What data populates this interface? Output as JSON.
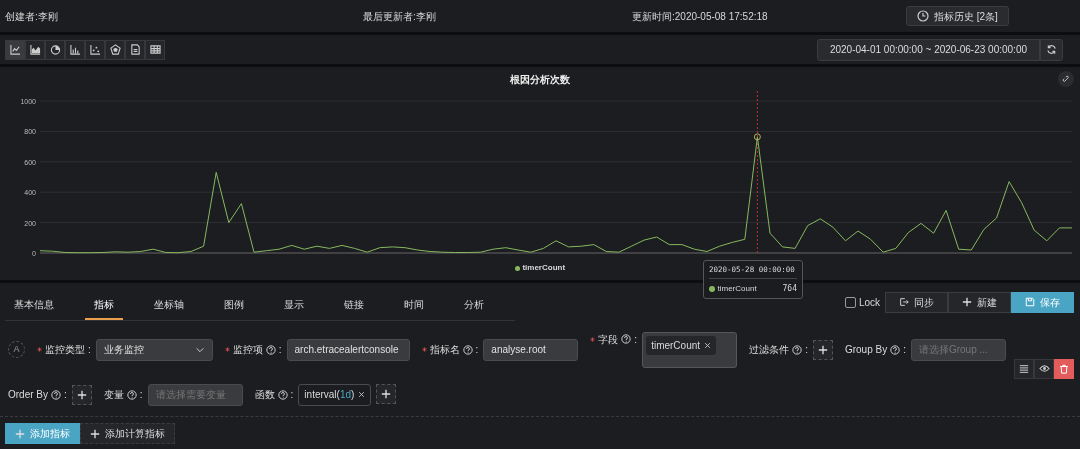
{
  "header": {
    "creator": "创建者:李刚",
    "last_editor": "最后更新者:李刚",
    "updated": "更新时间:2020-05-08 17:52:18",
    "history_button": "指标历史 [2条]"
  },
  "chart_types": [
    {
      "kind": "line",
      "selected": true
    },
    {
      "kind": "area",
      "selected": false
    },
    {
      "kind": "pie",
      "selected": false
    },
    {
      "kind": "bar",
      "selected": false
    },
    {
      "kind": "scatter",
      "selected": false
    },
    {
      "kind": "radar",
      "selected": false
    },
    {
      "kind": "document",
      "selected": false
    },
    {
      "kind": "table",
      "selected": false
    }
  ],
  "time_range": "2020-04-01 00:00:00 ~ 2020-06-23 00:00:00",
  "panel": {
    "title": "根因分析次数",
    "chart_data": {
      "type": "line",
      "grid": true,
      "ylim": [
        0,
        1000
      ],
      "yticks": [
        0,
        200,
        400,
        600,
        800,
        1000
      ],
      "series": [
        {
          "name": "timerCount",
          "color": "#86b85e",
          "values": [
            15,
            12,
            3,
            2,
            2,
            3,
            8,
            5,
            10,
            25,
            3,
            2,
            10,
            45,
            530,
            200,
            325,
            5,
            15,
            25,
            50,
            25,
            45,
            30,
            50,
            30,
            5,
            35,
            40,
            35,
            20,
            10,
            5,
            3,
            3,
            5,
            25,
            35,
            20,
            5,
            30,
            80,
            40,
            45,
            55,
            10,
            5,
            45,
            85,
            105,
            55,
            55,
            25,
            10,
            45,
            70,
            90,
            764,
            130,
            40,
            30,
            180,
            225,
            170,
            80,
            145,
            90,
            5,
            30,
            135,
            195,
            130,
            280,
            25,
            20,
            155,
            230,
            470,
            330,
            150,
            80,
            165,
            165
          ]
        }
      ]
    },
    "tooltip": {
      "date": "2020-05-28 00:00:00",
      "series": "timerCount",
      "value": "764"
    }
  },
  "tabs": [
    {
      "label": "基本信息",
      "selected": false
    },
    {
      "label": "指标",
      "selected": true
    },
    {
      "label": "坐标轴",
      "selected": false
    },
    {
      "label": "图例",
      "selected": false
    },
    {
      "label": "显示",
      "selected": false
    },
    {
      "label": "链接",
      "selected": false
    },
    {
      "label": "时间",
      "selected": false
    },
    {
      "label": "分析",
      "selected": false
    }
  ],
  "lock": {
    "label": "Lock",
    "checked": false
  },
  "actions": [
    {
      "kind": "sync",
      "label": "同步"
    },
    {
      "kind": "new",
      "label": "新建"
    },
    {
      "kind": "save",
      "label": "保存"
    }
  ],
  "query": {
    "letter": "A",
    "lines": [
      {
        "fields": [
          {
            "kind": "select",
            "label": "监控类型",
            "colon": ":",
            "required": true,
            "help": false,
            "value": "业务监控"
          },
          {
            "kind": "input",
            "label": "监控项",
            "colon": ":",
            "required": true,
            "help": true,
            "value": "arch.etracealertconsole"
          },
          {
            "kind": "input",
            "label": "指标名",
            "colon": ":",
            "required": true,
            "help": true,
            "value": "analyse.root"
          },
          {
            "kind": "tags",
            "label": "字段",
            "colon": ":",
            "required": true,
            "help": true,
            "tags": [
              {
                "parts": [
                  {
                    "text": "timerCount",
                    "accent": false
                  }
                ]
              }
            ]
          },
          {
            "kind": "add",
            "label": "过滤条件",
            "colon": ":",
            "required": false,
            "help": true
          },
          {
            "kind": "input",
            "label": "Group By",
            "colon": ":",
            "required": false,
            "help": true,
            "placeholder": "请选择Group ..."
          }
        ]
      },
      {
        "fields": [
          {
            "kind": "add",
            "label": "Order By",
            "colon": ":",
            "required": false,
            "help": true
          },
          {
            "kind": "input",
            "label": "变量",
            "colon": ":",
            "required": false,
            "help": true,
            "placeholder": "请选择需要变量"
          },
          {
            "kind": "functions",
            "label": "函数",
            "colon": ":",
            "required": false,
            "help": true,
            "tags": [
              {
                "parts": [
                  {
                    "text": "interval(",
                    "accent": false
                  },
                  {
                    "text": "1d",
                    "accent": true
                  },
                  {
                    "text": ")",
                    "accent": false
                  }
                ]
              }
            ]
          }
        ]
      }
    ]
  },
  "item_tools": [
    {
      "kind": "list"
    },
    {
      "kind": "view"
    },
    {
      "kind": "delete"
    }
  ],
  "bottom_buttons": [
    {
      "label": "添加指标",
      "primary": true
    },
    {
      "label": "添加计算指标",
      "primary": false
    }
  ]
}
